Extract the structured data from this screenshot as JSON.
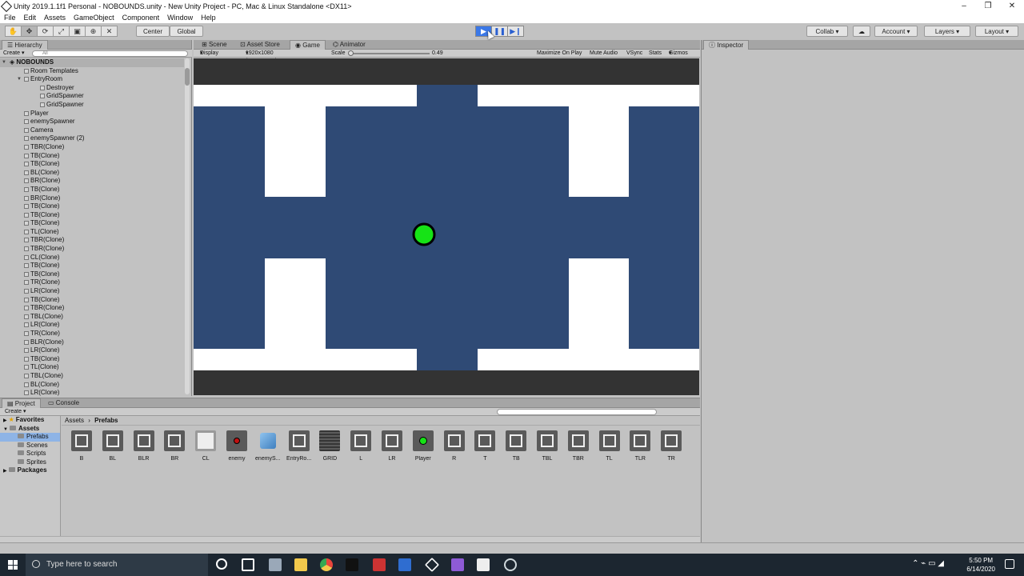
{
  "window": {
    "title": "Unity 2019.1.1f1 Personal - NOBOUNDS.unity - New Unity Project - PC, Mac & Linux Standalone <DX11>",
    "controls": [
      "–",
      "❐",
      "✕"
    ]
  },
  "menu": [
    "File",
    "Edit",
    "Assets",
    "GameObject",
    "Component",
    "Window",
    "Help"
  ],
  "toolbar": {
    "tools": [
      "hand",
      "move",
      "rotate",
      "scale",
      "rect",
      "transform",
      "custom"
    ],
    "pivot": "Center",
    "space": "Global",
    "play_state": "playing",
    "collab": "Collab",
    "account": "Account",
    "layers": "Layers",
    "layout": "Layout"
  },
  "hierarchy": {
    "tab": "Hierarchy",
    "create": "Create",
    "search_placeholder": "All",
    "scene": "NOBOUNDS",
    "rows": [
      {
        "label": "Room Templates",
        "indent": 1
      },
      {
        "label": "EntryRoom",
        "indent": 1,
        "expanded": true
      },
      {
        "label": "Destroyer",
        "indent": 2
      },
      {
        "label": "GridSpawner",
        "indent": 2
      },
      {
        "label": "GridSpawner",
        "indent": 2
      },
      {
        "label": "Player",
        "indent": 1
      },
      {
        "label": "enemySpawner",
        "indent": 1
      },
      {
        "label": "Camera",
        "indent": 1
      },
      {
        "label": "enemySpawner (2)",
        "indent": 1
      },
      {
        "label": "TBR(Clone)",
        "indent": 1
      },
      {
        "label": "TB(Clone)",
        "indent": 1
      },
      {
        "label": "TB(Clone)",
        "indent": 1
      },
      {
        "label": "BL(Clone)",
        "indent": 1
      },
      {
        "label": "BR(Clone)",
        "indent": 1
      },
      {
        "label": "TB(Clone)",
        "indent": 1
      },
      {
        "label": "BR(Clone)",
        "indent": 1
      },
      {
        "label": "TB(Clone)",
        "indent": 1
      },
      {
        "label": "TB(Clone)",
        "indent": 1
      },
      {
        "label": "TB(Clone)",
        "indent": 1
      },
      {
        "label": "TL(Clone)",
        "indent": 1
      },
      {
        "label": "TBR(Clone)",
        "indent": 1
      },
      {
        "label": "TBR(Clone)",
        "indent": 1
      },
      {
        "label": "CL(Clone)",
        "indent": 1
      },
      {
        "label": "TB(Clone)",
        "indent": 1
      },
      {
        "label": "TB(Clone)",
        "indent": 1
      },
      {
        "label": "TR(Clone)",
        "indent": 1
      },
      {
        "label": "LR(Clone)",
        "indent": 1
      },
      {
        "label": "TB(Clone)",
        "indent": 1
      },
      {
        "label": "TBR(Clone)",
        "indent": 1
      },
      {
        "label": "TBL(Clone)",
        "indent": 1
      },
      {
        "label": "LR(Clone)",
        "indent": 1
      },
      {
        "label": "TR(Clone)",
        "indent": 1
      },
      {
        "label": "BLR(Clone)",
        "indent": 1
      },
      {
        "label": "LR(Clone)",
        "indent": 1
      },
      {
        "label": "TB(Clone)",
        "indent": 1
      },
      {
        "label": "TL(Clone)",
        "indent": 1
      },
      {
        "label": "TBL(Clone)",
        "indent": 1
      },
      {
        "label": "BL(Clone)",
        "indent": 1
      },
      {
        "label": "LR(Clone)",
        "indent": 1
      }
    ]
  },
  "center_tabs": [
    "Scene",
    "Asset Store",
    "Game",
    "Animator"
  ],
  "center_active_tab": "Game",
  "game_bar": {
    "display": "Display 1",
    "resolution": "1920x1080 (1920x1080)",
    "scale_label": "Scale",
    "scale_value": "0.49",
    "toggles": [
      "Maximize On Play",
      "Mute Audio",
      "VSync",
      "Stats",
      "Gizmos"
    ]
  },
  "game_colors": {
    "letterbox": "#333333",
    "wall": "#ffffff",
    "floor": "#2f4a75",
    "player": "#16e316",
    "outline": "#000000"
  },
  "inspector": {
    "tab": "Inspector"
  },
  "project": {
    "tabs": [
      "Project",
      "Console"
    ],
    "create": "Create",
    "tree": [
      {
        "label": "Favorites",
        "bold": true,
        "kind": "star"
      },
      {
        "label": "Assets",
        "bold": true,
        "kind": "folder"
      },
      {
        "label": "Prefabs",
        "kind": "folder",
        "indent": 1,
        "selected": true
      },
      {
        "label": "Scenes",
        "kind": "folder",
        "indent": 1
      },
      {
        "label": "Scripts",
        "kind": "folder",
        "indent": 1
      },
      {
        "label": "Sprites",
        "kind": "folder",
        "indent": 1
      },
      {
        "label": "Packages",
        "bold": true,
        "kind": "folder"
      }
    ],
    "breadcrumb": [
      "Assets",
      "Prefabs"
    ],
    "assets": [
      {
        "label": "B",
        "kind": "room"
      },
      {
        "label": "BL",
        "kind": "room"
      },
      {
        "label": "BLR",
        "kind": "room"
      },
      {
        "label": "BR",
        "kind": "room"
      },
      {
        "label": "CL",
        "kind": "white"
      },
      {
        "label": "enemy",
        "kind": "enemy"
      },
      {
        "label": "enemyS...",
        "kind": "cube"
      },
      {
        "label": "EntryRo...",
        "kind": "room"
      },
      {
        "label": "GRID",
        "kind": "grid"
      },
      {
        "label": "L",
        "kind": "room"
      },
      {
        "label": "LR",
        "kind": "room"
      },
      {
        "label": "Player",
        "kind": "player"
      },
      {
        "label": "R",
        "kind": "room"
      },
      {
        "label": "T",
        "kind": "room"
      },
      {
        "label": "TB",
        "kind": "room"
      },
      {
        "label": "TBL",
        "kind": "room"
      },
      {
        "label": "TBR",
        "kind": "room"
      },
      {
        "label": "TL",
        "kind": "room"
      },
      {
        "label": "TLR",
        "kind": "room"
      },
      {
        "label": "TR",
        "kind": "room"
      }
    ]
  },
  "taskbar": {
    "search_placeholder": "Type here to search",
    "time": "5:50 PM",
    "date": "6/14/2020",
    "apps": [
      "cortana-icon",
      "task-view-icon",
      "app-icon",
      "file-explorer-icon",
      "chrome-icon",
      "terminal-icon",
      "mail-icon",
      "photoshop-icon",
      "unity-icon",
      "visual-studio-icon",
      "app-icon-2",
      "steam-icon"
    ]
  }
}
